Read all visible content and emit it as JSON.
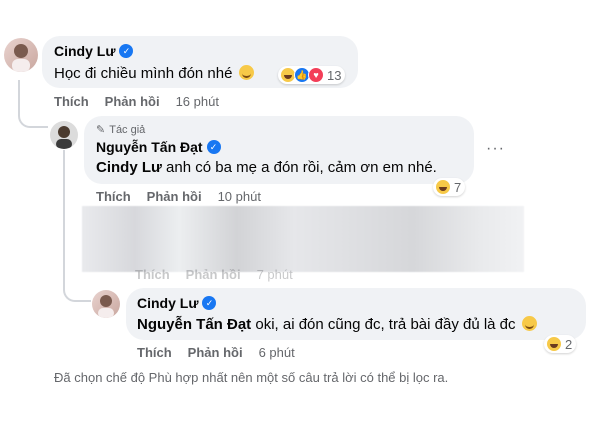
{
  "comment1": {
    "author": "Cindy Lư",
    "text": "Học đi chiều mình đón nhé",
    "reactions_count": "13",
    "actions": {
      "like": "Thích",
      "reply": "Phản hồi",
      "time": "16 phút"
    }
  },
  "reply1": {
    "badge": "Tác giả",
    "author": "Nguyễn Tấn Đạt",
    "mention": "Cindy Lư",
    "text": " anh có ba mẹ a đón rồi, cảm ơn em nhé.",
    "reactions_count": "7",
    "actions": {
      "like": "Thích",
      "reply": "Phản hồi",
      "time": "10 phút"
    }
  },
  "hidden_reply": {
    "actions": {
      "like": "Thích",
      "reply": "Phản hồi",
      "time": "7 phút"
    }
  },
  "reply2": {
    "author": "Cindy Lư",
    "mention": "Nguyễn Tấn Đạt",
    "text": " oki, ai đón cũng đc, trả bài đầy đủ là đc",
    "reactions_count": "2",
    "actions": {
      "like": "Thích",
      "reply": "Phản hồi",
      "time": "6 phút"
    }
  },
  "footer_note": "Đã chọn chế độ Phù hợp nhất nên một số câu trả lời có thể bị lọc ra.",
  "colors": {
    "verified": "#1877f2",
    "bubble": "#f0f2f5",
    "muted": "#65676b"
  }
}
